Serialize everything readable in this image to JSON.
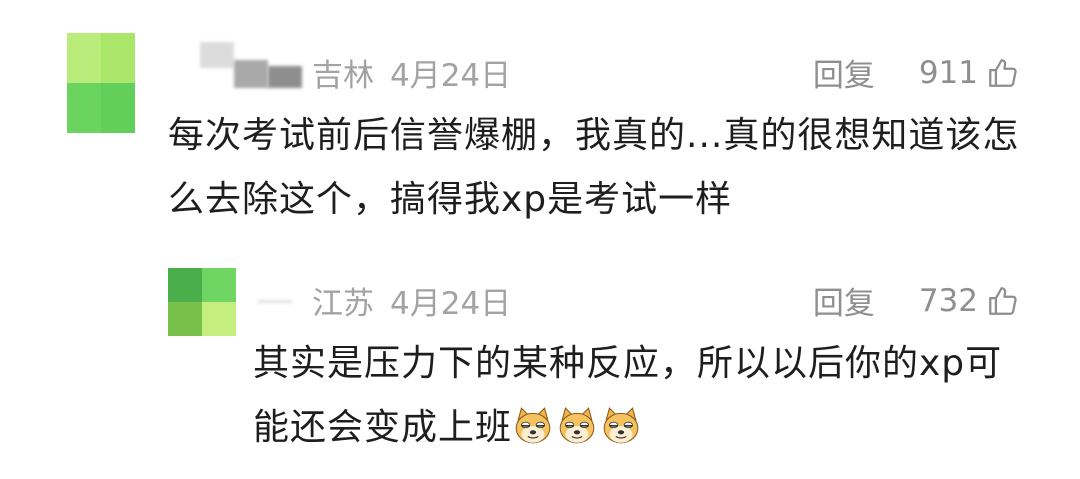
{
  "comments": [
    {
      "location": "吉林",
      "date": "4月24日",
      "reply_label": "回复",
      "likes": "911",
      "text": "每次考试前后信誉爆棚，我真的...真的很想知道该怎么去除这个，搞得我xp是考试一样"
    },
    {
      "location": "江苏",
      "date": "4月24日",
      "reply_label": "回复",
      "likes": "732",
      "text": "其实是压力下的某种反应，所以以后你的xp可能还会变成上班",
      "emoji_count": 3,
      "emoji_name": "doge-emoji"
    }
  ],
  "colors": {
    "avatar_light": "#b5eb72",
    "avatar_mid": "#6cd35c",
    "avatar_dark": "#3fa348",
    "meta_text": "#a3a3a3"
  }
}
